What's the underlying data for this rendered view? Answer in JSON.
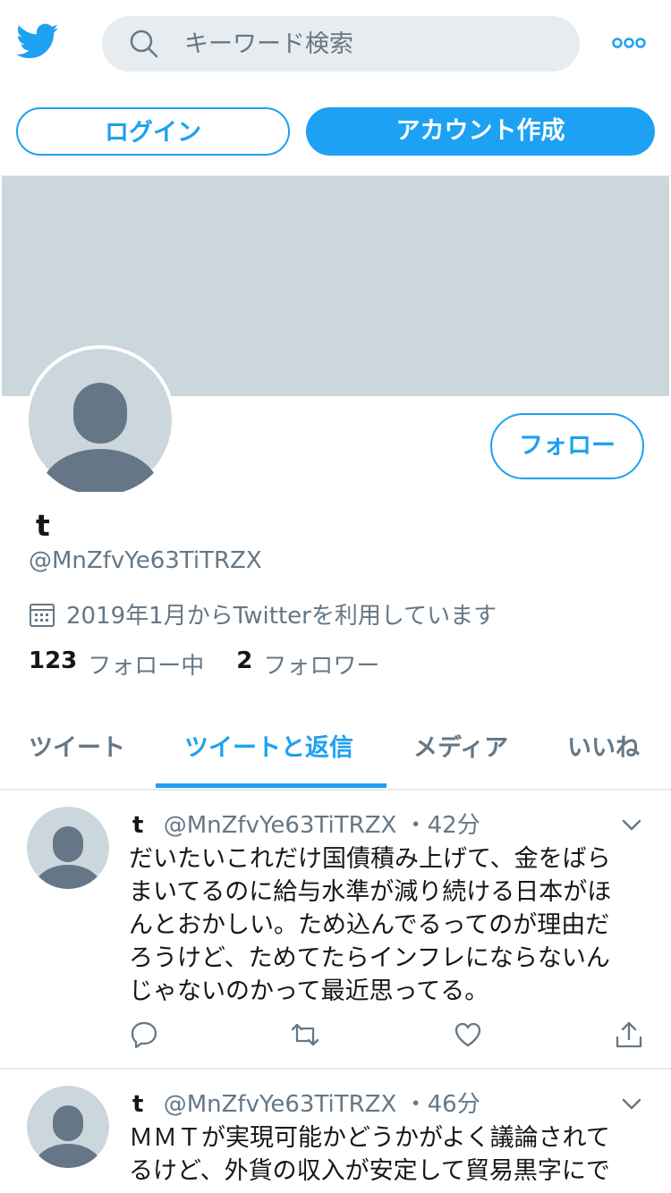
{
  "header": {
    "logo_icon": "twitter-bird-icon",
    "search_placeholder": "キーワード検索",
    "more_icon": "more-dots-icon",
    "login_label": "ログイン",
    "signup_label": "アカウント作成"
  },
  "profile": {
    "name": "t",
    "handle": "@MnZfvYe63TiTRZX",
    "joined": "2019年1月からTwitterを利用しています",
    "following_count": "123",
    "following_label": "フォロー中",
    "followers_count": "2",
    "followers_label": "フォロワー",
    "follow_label": "フォロー"
  },
  "tabs": [
    "ツイート",
    "ツイートと返信",
    "メディア",
    "いいね"
  ],
  "active_tab": "ツイートと返信",
  "tweets": [
    {
      "name": "t",
      "handle": "@MnZfvYe63TiTRZX",
      "time": "・42分",
      "lines": [
        "だいたいこれだけ国債積み上げて、金をばら",
        "まいてるのに給与水準が減り続ける日本がほ",
        "んとおかしい。ため込んでるってのが理由だ",
        "ろうけど、ためてたらインフレにならないん",
        "じゃないのかって最近思ってる。"
      ]
    },
    {
      "name": "t",
      "handle": "@MnZfvYe63TiTRZX",
      "time": "・46分",
      "lines": [
        "ＭＭＴが実現可能かどうかがよく議論されて",
        "るけど、外貨の収入が安定して貿易黒字にで"
      ]
    }
  ],
  "colors": {
    "accent": "#1da1f2",
    "banner": "#ccd6dd",
    "secondary_text": "#657786",
    "avatar_fill": "#657786",
    "avatar_bg": "#ccd6dd"
  }
}
